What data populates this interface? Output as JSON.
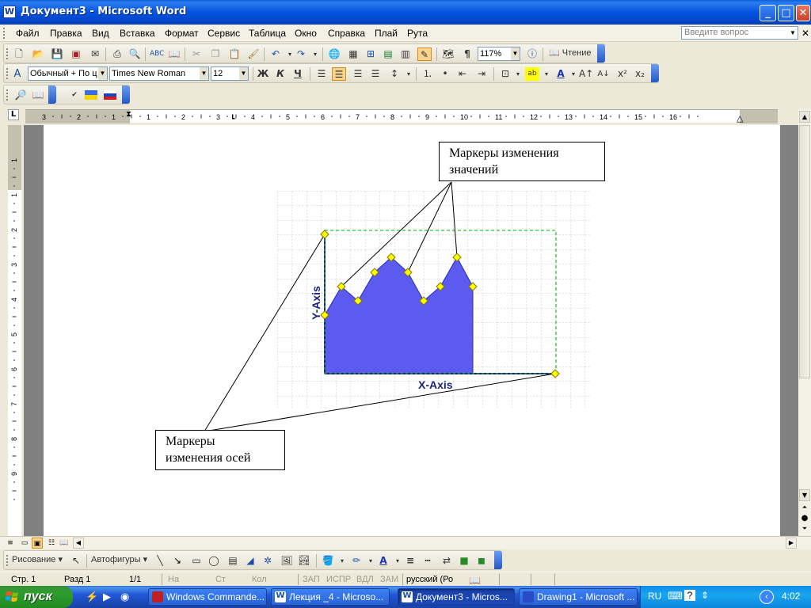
{
  "window": {
    "title": "Документ3 - Microsoft Word",
    "app_icon": "W"
  },
  "menu": [
    "Файл",
    "Правка",
    "Вид",
    "Вставка",
    "Формат",
    "Сервис",
    "Таблица",
    "Окно",
    "Справка",
    "Плай",
    "Рута"
  ],
  "ask_placeholder": "Введите вопрос",
  "toolbar": {
    "zoom": "117%",
    "read_label": "Чтение"
  },
  "format": {
    "style": "Обычный + По ц",
    "font": "Times New Roman",
    "size": "12"
  },
  "format_buttons": {
    "bold": "Ж",
    "italic": "К",
    "underline": "Ч"
  },
  "ruler": {
    "h_labels": [
      "3",
      "2",
      "1",
      "1",
      "2",
      "3",
      "4",
      "5",
      "6",
      "7",
      "8",
      "9",
      "10",
      "11",
      "12",
      "13",
      "14",
      "15",
      "16"
    ],
    "v_labels": [
      "1",
      "1",
      "2",
      "3",
      "4",
      "5",
      "6",
      "7",
      "8",
      "9"
    ],
    "corner": "L"
  },
  "figure": {
    "y_axis_label": "Y-Axis",
    "x_axis_label": "X-Axis",
    "callout_values": "Маркеры изменения значений",
    "callout_axes": "Маркеры изменения осей"
  },
  "drawing": {
    "draw_label": "Рисование",
    "autoshapes_label": "Автофигуры"
  },
  "status": {
    "page": "Стр. 1",
    "section": "Разд 1",
    "pages": "1/1",
    "at": "На",
    "line": "Ст",
    "col": "Кол",
    "rec": "ЗАП",
    "trk": "ИСПР",
    "ext": "ВДЛ",
    "ovr": "ЗАМ",
    "lang": "русский (Ро"
  },
  "taskbar": {
    "start": "пуск",
    "tasks": [
      "Windows Commande...",
      "Лекция _4 - Microso...",
      "Документ3 - Micros...",
      "Drawing1 - Microsoft ..."
    ],
    "lang": "RU",
    "clock": "4:02"
  },
  "colors": {
    "fill": "#5b5bf0",
    "marker": "#ffff00",
    "accent": "#0454e0"
  }
}
